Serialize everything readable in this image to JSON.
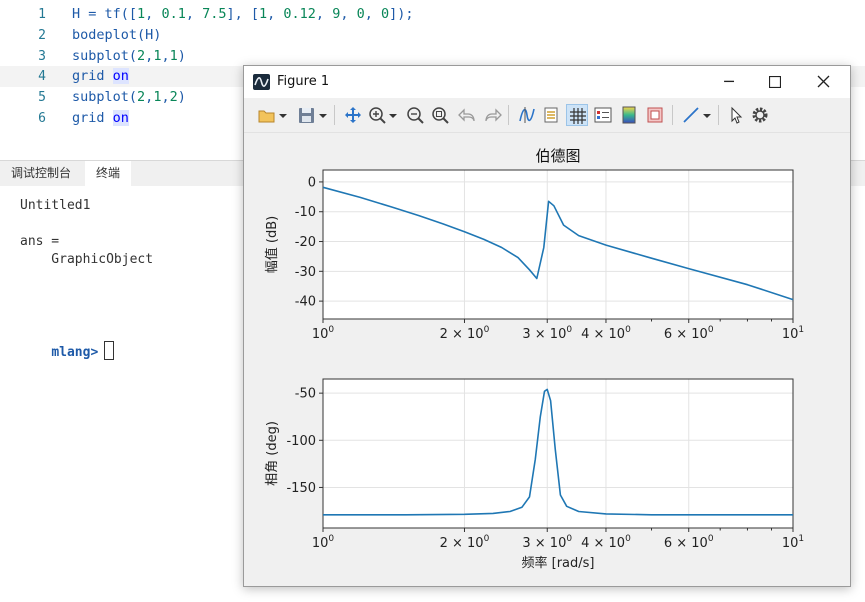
{
  "editor": {
    "lines": [
      {
        "n": "1",
        "tokens": [
          {
            "t": "H = tf([",
            "c": "plain"
          },
          {
            "t": "1",
            "c": "num"
          },
          {
            "t": ", ",
            "c": "plain"
          },
          {
            "t": "0.1",
            "c": "num"
          },
          {
            "t": ", ",
            "c": "plain"
          },
          {
            "t": "7.5",
            "c": "num"
          },
          {
            "t": "], [",
            "c": "plain"
          },
          {
            "t": "1",
            "c": "num"
          },
          {
            "t": ", ",
            "c": "plain"
          },
          {
            "t": "0.12",
            "c": "num"
          },
          {
            "t": ", ",
            "c": "plain"
          },
          {
            "t": "9",
            "c": "num"
          },
          {
            "t": ", ",
            "c": "plain"
          },
          {
            "t": "0",
            "c": "num"
          },
          {
            "t": ", ",
            "c": "plain"
          },
          {
            "t": "0",
            "c": "num"
          },
          {
            "t": "]);",
            "c": "plain"
          }
        ]
      },
      {
        "n": "2",
        "tokens": [
          {
            "t": "bodeplot(H)",
            "c": "plain"
          }
        ]
      },
      {
        "n": "3",
        "tokens": [
          {
            "t": "subplot(",
            "c": "plain"
          },
          {
            "t": "2",
            "c": "num"
          },
          {
            "t": ",",
            "c": "plain"
          },
          {
            "t": "1",
            "c": "num"
          },
          {
            "t": ",",
            "c": "plain"
          },
          {
            "t": "1",
            "c": "num"
          },
          {
            "t": ")",
            "c": "plain"
          }
        ]
      },
      {
        "n": "4",
        "current": true,
        "tokens": [
          {
            "t": "grid ",
            "c": "plain"
          },
          {
            "t": "on",
            "c": "kw"
          }
        ]
      },
      {
        "n": "5",
        "tokens": [
          {
            "t": "subplot(",
            "c": "plain"
          },
          {
            "t": "2",
            "c": "num"
          },
          {
            "t": ",",
            "c": "plain"
          },
          {
            "t": "1",
            "c": "num"
          },
          {
            "t": ",",
            "c": "plain"
          },
          {
            "t": "2",
            "c": "num"
          },
          {
            "t": ")",
            "c": "plain"
          }
        ]
      },
      {
        "n": "6",
        "tokens": [
          {
            "t": "grid ",
            "c": "plain"
          },
          {
            "t": "on",
            "c": "kw"
          }
        ]
      }
    ]
  },
  "tabs": [
    {
      "label": "调试控制台",
      "active": false
    },
    {
      "label": "终端",
      "active": true
    }
  ],
  "console": {
    "lines": [
      "Untitled1",
      "",
      "ans =",
      "    GraphicObject"
    ],
    "prompt": "mlang>"
  },
  "figure": {
    "title": "Figure 1",
    "controls": {
      "minimize": "─",
      "maximize": "☐",
      "close": "✕"
    },
    "toolbar_icons": [
      "open-icon",
      "dropdown-arrow-icon",
      "save-icon",
      "dropdown-arrow-icon",
      "pan-icon",
      "zoom-in-icon",
      "dropdown-arrow-icon",
      "zoom-out-icon",
      "zoom-fit-icon",
      "undo-icon",
      "redo-icon",
      "data-cursor-icon",
      "rotate-icon",
      "grid-icon",
      "legend-icon",
      "colorbar-icon",
      "axes-box-icon",
      "line-tool-icon",
      "dropdown-arrow-icon",
      "select-pointer-icon",
      "settings-gear-icon"
    ],
    "accent_color": "#1f77b4"
  },
  "chart_data": [
    {
      "type": "line",
      "title": "伯德图",
      "xlabel": "",
      "ylabel": "幅值 (dB)",
      "xscale": "log",
      "xlim": [
        1,
        10
      ],
      "ylim": [
        -46,
        4
      ],
      "grid": true,
      "yticks": [
        0,
        -10,
        -20,
        -30,
        -40
      ],
      "ytick_labels": [
        "0",
        "-10",
        "-20",
        "-30",
        "-40"
      ],
      "xticks": [
        1,
        2,
        3,
        4,
        6,
        10
      ],
      "xtick_labels": [
        {
          "b": "10",
          "e": "0"
        },
        {
          "b": "2 × 10",
          "e": "0"
        },
        {
          "b": "3 × 10",
          "e": "0"
        },
        {
          "b": "4 × 10",
          "e": "0"
        },
        {
          "b": "6 × 10",
          "e": "0"
        },
        {
          "b": "10",
          "e": "1"
        }
      ],
      "series": [
        {
          "color": "#1f77b4",
          "x": [
            1.0,
            1.2,
            1.4,
            1.6,
            1.8,
            2.0,
            2.2,
            2.4,
            2.6,
            2.75,
            2.85,
            2.95,
            3.02,
            3.1,
            3.25,
            3.5,
            4.0,
            5.0,
            6.0,
            8.0,
            10.0
          ],
          "values": [
            -1.8,
            -5.2,
            -8.4,
            -11.3,
            -14.1,
            -16.7,
            -19.3,
            -22.0,
            -25.4,
            -29.5,
            -32.4,
            -22.0,
            -6.5,
            -8.0,
            -14.5,
            -18.0,
            -21.2,
            -25.6,
            -29.1,
            -34.5,
            -39.5
          ]
        }
      ]
    },
    {
      "type": "line",
      "title": "",
      "xlabel": "频率 [rad/s]",
      "ylabel": "相角 (deg)",
      "xscale": "log",
      "xlim": [
        1,
        10
      ],
      "ylim": [
        -193,
        -35
      ],
      "grid": true,
      "yticks": [
        -50,
        -100,
        -150
      ],
      "ytick_labels": [
        "-50",
        "-100",
        "-150"
      ],
      "xticks": [
        1,
        2,
        3,
        4,
        6,
        10
      ],
      "xtick_labels": [
        {
          "b": "10",
          "e": "0"
        },
        {
          "b": "2 × 10",
          "e": "0"
        },
        {
          "b": "3 × 10",
          "e": "0"
        },
        {
          "b": "4 × 10",
          "e": "0"
        },
        {
          "b": "6 × 10",
          "e": "0"
        },
        {
          "b": "10",
          "e": "1"
        }
      ],
      "series": [
        {
          "color": "#1f77b4",
          "x": [
            1.0,
            1.5,
            2.0,
            2.3,
            2.5,
            2.65,
            2.75,
            2.83,
            2.9,
            2.96,
            3.0,
            3.05,
            3.12,
            3.2,
            3.3,
            3.5,
            4.0,
            5.0,
            6.0,
            8.0,
            10.0
          ],
          "values": [
            -179,
            -179,
            -178.5,
            -177.5,
            -175.5,
            -171,
            -160,
            -120,
            -75,
            -48,
            -46,
            -58,
            -110,
            -158,
            -170,
            -175.5,
            -178,
            -179,
            -179,
            -179,
            -179
          ]
        }
      ]
    }
  ]
}
